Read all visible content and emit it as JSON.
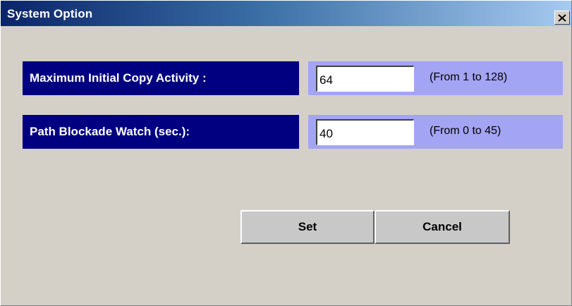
{
  "window": {
    "title": "System Option"
  },
  "fields": [
    {
      "label": "Maximum Initial Copy Activity :",
      "value": "64",
      "range": "(From 1 to 128)"
    },
    {
      "label": "Path Blockade Watch (sec.):",
      "value": "40",
      "range": "(From 0 to 45)"
    }
  ],
  "buttons": {
    "set_label": "Set",
    "cancel_label": "Cancel"
  },
  "icons": {
    "close": "close-icon"
  },
  "colors": {
    "label_background": "#000080",
    "value_background": "#a4a4f4",
    "dialog_background": "#d4d0c8"
  }
}
